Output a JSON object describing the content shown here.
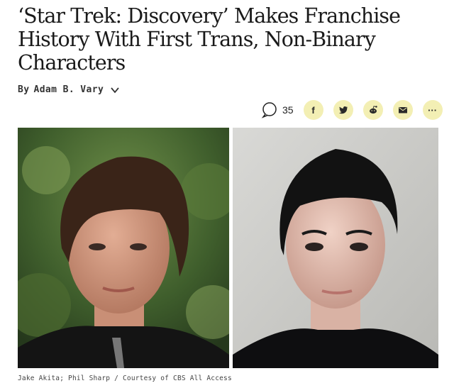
{
  "article": {
    "headline": "‘Star Trek: Discovery’ Makes Franchise History With First Trans, Non-Binary Characters",
    "byline_prefix": "By",
    "author": "Adam B. Vary"
  },
  "share": {
    "comment_count": "35",
    "facebook_glyph": "f",
    "more_glyph": "···",
    "icons": [
      "comment-icon",
      "facebook-icon",
      "twitter-icon",
      "reddit-icon",
      "email-icon",
      "more-icon"
    ],
    "button_color": "#f3efb4"
  },
  "photo": {
    "credit": "Jake Akita; Phil Sharp / Courtesy of CBS All Access"
  }
}
